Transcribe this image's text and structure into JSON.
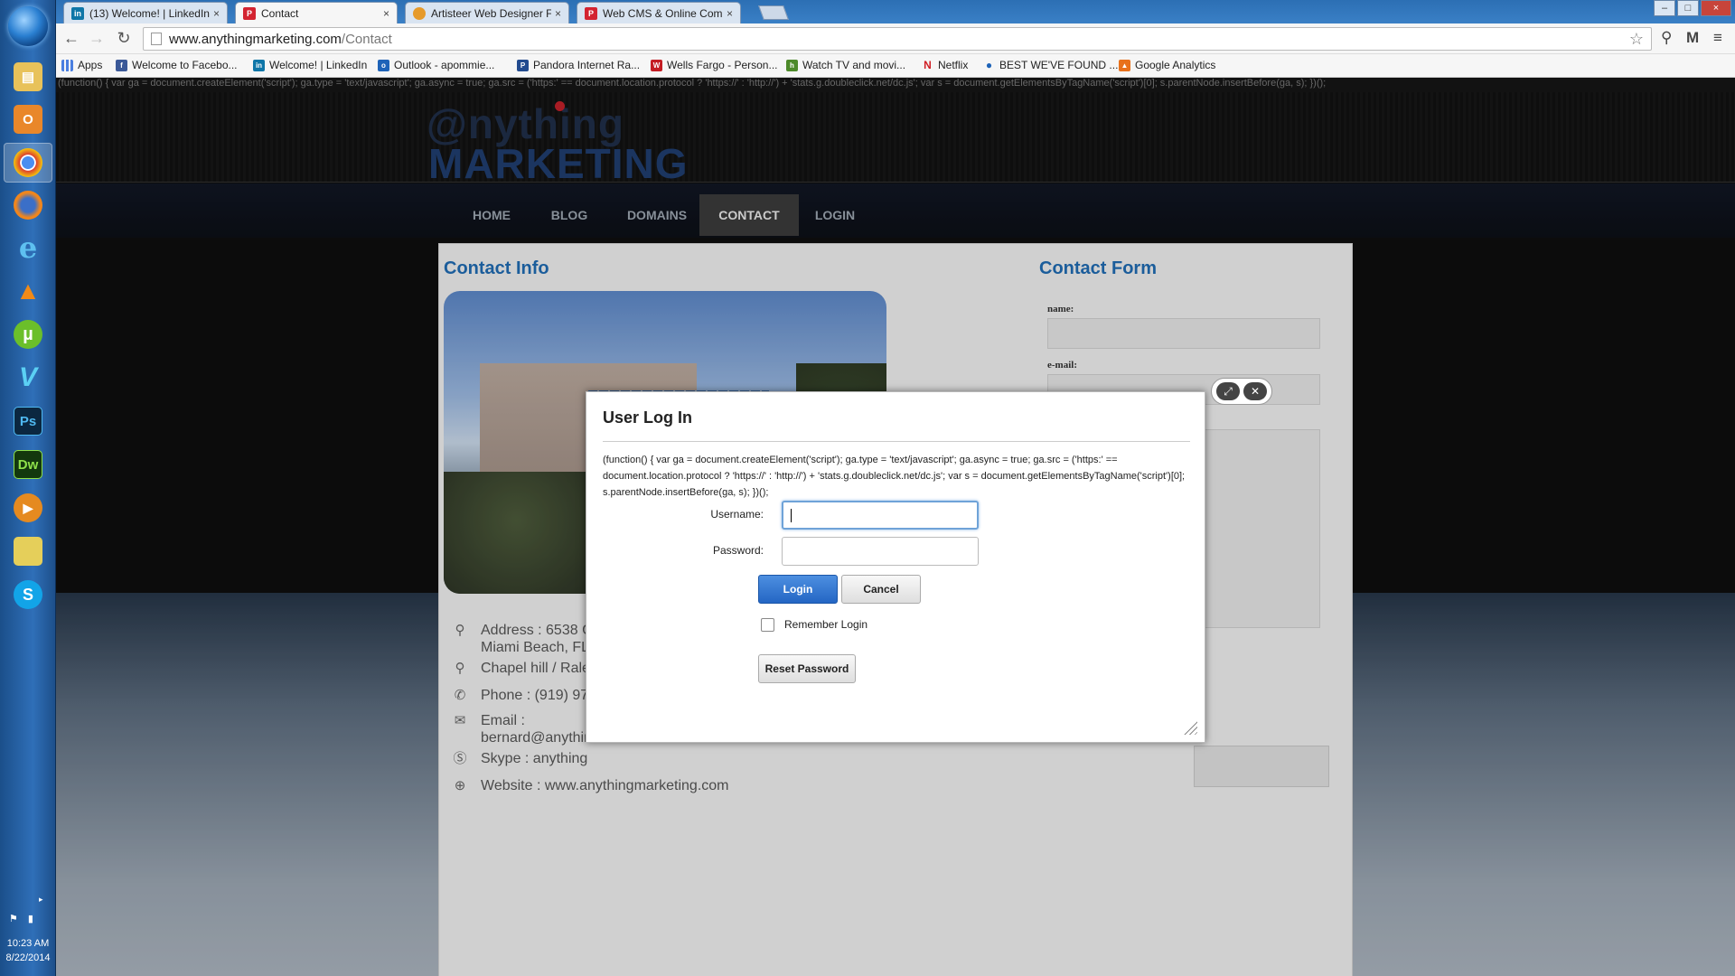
{
  "tabs": [
    {
      "title": "(13) Welcome! | LinkedIn",
      "icon": "linkedin-icon"
    },
    {
      "title": "Contact",
      "icon": "page-icon"
    },
    {
      "title": "Artisteer Web Designer Fo",
      "icon": "artisteer-icon"
    },
    {
      "title": "Web CMS & Online Comr",
      "icon": "page-icon"
    }
  ],
  "address": {
    "domain": "www.anythingmarketing.com",
    "path": "/Contact"
  },
  "bookmarks": [
    {
      "label": "Apps",
      "icon": "apps-icon"
    },
    {
      "label": "Welcome to Facebo...",
      "icon": "facebook-icon"
    },
    {
      "label": "Welcome! | LinkedIn",
      "icon": "linkedin-icon"
    },
    {
      "label": "Outlook - apommie...",
      "icon": "outlook-icon"
    },
    {
      "label": "Pandora Internet Ra...",
      "icon": "pandora-icon"
    },
    {
      "label": "Wells Fargo - Person...",
      "icon": "wellsfargo-icon"
    },
    {
      "label": "Watch TV and movi...",
      "icon": "hulu-icon"
    },
    {
      "label": "Netflix",
      "icon": "netflix-icon"
    },
    {
      "label": "BEST WE'VE FOUND ...",
      "icon": "bookmark-icon"
    },
    {
      "label": "Google Analytics",
      "icon": "analytics-icon"
    }
  ],
  "js_snippet": "(function() { var ga = document.createElement('script'); ga.type = 'text/javascript'; ga.async = true; ga.src = ('https:' == document.location.protocol ? 'https://' : 'http://') + 'stats.g.doubleclick.net/dc.js'; var s = document.getElementsByTagName('script')[0]; s.parentNode.insertBefore(ga, s); })();",
  "site": {
    "logo_line1": "@nything",
    "logo_line2": "MARKETING",
    "nav": [
      "HOME",
      "BLOG",
      "DOMAINS",
      "CONTACT",
      "LOGIN"
    ],
    "active_nav": "CONTACT"
  },
  "contact_info": {
    "heading": "Contact Info",
    "address_line1": "Address : 6538 C",
    "address_line2": "Miami Beach, FL",
    "location2": "Chapel hill / Rale",
    "phone": "Phone : (919) 97",
    "email_label": "Email :",
    "email_value": "bernard@anythin",
    "skype": "Skype : anything",
    "website": "Website : www.anythingmarketing.com"
  },
  "contact_form": {
    "heading": "Contact Form",
    "name_label": "name:",
    "email_label": "e-mail:"
  },
  "login_modal": {
    "title": "User Log In",
    "username_label": "Username:",
    "password_label": "Password:",
    "login_button": "Login",
    "cancel_button": "Cancel",
    "remember_label": "Remember Login",
    "reset_button": "Reset Password"
  },
  "tray": {
    "time": "10:23 AM",
    "date": "8/22/2014"
  }
}
